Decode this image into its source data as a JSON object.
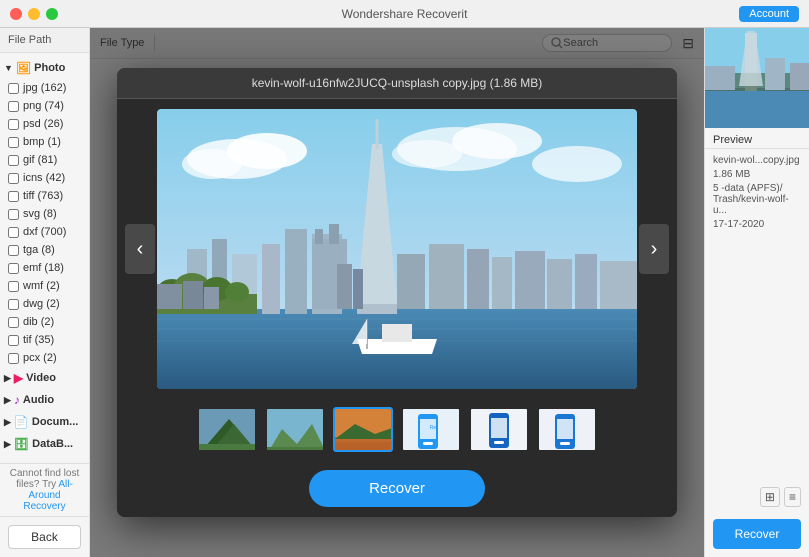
{
  "app": {
    "title": "Wondershare Recoverit",
    "account_label": "Account"
  },
  "toolbar": {
    "file_path_label": "File Path",
    "file_type_label": "File Type",
    "search_placeholder": "Search"
  },
  "sidebar": {
    "categories": [
      {
        "name": "photo",
        "label": "Photo",
        "icon": "photo",
        "expanded": true,
        "items": [
          {
            "label": "jpg (162)",
            "checked": false
          },
          {
            "label": "png (74)",
            "checked": false
          },
          {
            "label": "psd (26)",
            "checked": false
          },
          {
            "label": "bmp (1)",
            "checked": false
          },
          {
            "label": "gif (81)",
            "checked": false
          },
          {
            "label": "icns (42)",
            "checked": false
          },
          {
            "label": "tiff (763)",
            "checked": false
          },
          {
            "label": "svg (8)",
            "checked": false
          },
          {
            "label": "dxf (700)",
            "checked": false
          },
          {
            "label": "tga (8)",
            "checked": false
          },
          {
            "label": "emf (18)",
            "checked": false
          },
          {
            "label": "wmf (2)",
            "checked": false
          },
          {
            "label": "dwg (2)",
            "checked": false
          },
          {
            "label": "dib (2)",
            "checked": false
          },
          {
            "label": "tif (35)",
            "checked": false
          },
          {
            "label": "pcx (2)",
            "checked": false
          }
        ]
      },
      {
        "name": "video",
        "label": "Video",
        "icon": "video",
        "expanded": false,
        "items": []
      },
      {
        "name": "audio",
        "label": "Audio",
        "icon": "audio",
        "expanded": false,
        "items": []
      },
      {
        "name": "document",
        "label": "Document",
        "icon": "document",
        "expanded": false,
        "items": []
      },
      {
        "name": "database",
        "label": "DataB...",
        "icon": "database",
        "expanded": false,
        "items": []
      }
    ],
    "back_button": "Back",
    "bottom_text": "Cannot find lost files? Try ",
    "bottom_link": "All-Around Recovery"
  },
  "preview": {
    "filename": "kevin-wolf-u16nfw2JUCQ-unsplash copy.jpg (1.86 MB)",
    "recover_button": "Recover",
    "thumbnails": [
      {
        "id": 1,
        "label": "mountain-trees",
        "selected": false
      },
      {
        "id": 2,
        "label": "mountain-valley",
        "selected": false
      },
      {
        "id": 3,
        "label": "lake-sunset",
        "selected": true
      },
      {
        "id": 4,
        "label": "phone-app-1",
        "selected": false
      },
      {
        "id": 5,
        "label": "phone-app-2",
        "selected": false
      },
      {
        "id": 6,
        "label": "phone-app-3",
        "selected": false
      }
    ]
  },
  "right_panel": {
    "preview_label": "Preview",
    "info": {
      "filename": "kevin-wol...copy.jpg",
      "size": "1.86 MB",
      "location": "5 -data (APFS)/\nTrash/kevin-wolf-u...",
      "date": "17-17-2020"
    },
    "recover_button": "Recover",
    "view_icons": {
      "grid": "⊞",
      "list": "≡"
    }
  }
}
